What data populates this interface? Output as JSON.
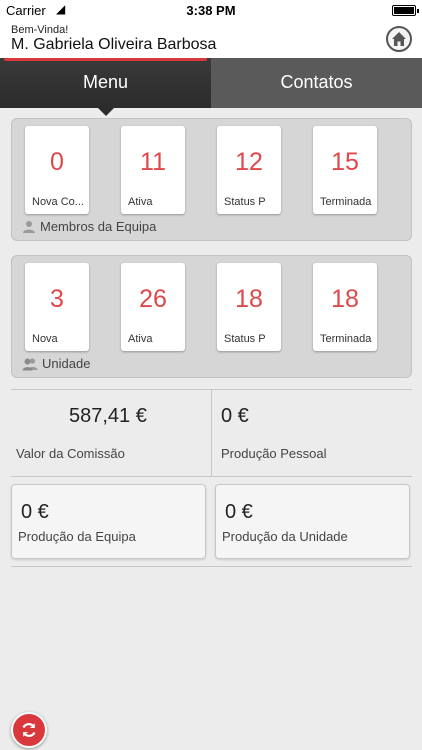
{
  "status_bar": {
    "carrier": "Carrier",
    "time": "3:38 PM"
  },
  "header": {
    "welcome": "Bem-Vinda!",
    "user_name": "M. Gabriela Oliveira Barbosa"
  },
  "tabs": {
    "menu": "Menu",
    "contacts": "Contatos"
  },
  "team_group": {
    "caption": "Membros da Equipa",
    "cards": [
      {
        "value": "0",
        "label": "Nova Co..."
      },
      {
        "value": "11",
        "label": "Ativa"
      },
      {
        "value": "12",
        "label": "Status P"
      },
      {
        "value": "15",
        "label": "Terminada"
      }
    ]
  },
  "unit_group": {
    "caption": "Unidade",
    "cards": [
      {
        "value": "3",
        "label": "Nova"
      },
      {
        "value": "26",
        "label": "Ativa"
      },
      {
        "value": "18",
        "label": "Status P"
      },
      {
        "value": "18",
        "label": "Terminada"
      }
    ]
  },
  "metrics": {
    "commission": {
      "value": "587,41 €",
      "label": "Valor da Comissão"
    },
    "personal": {
      "value": "0 €",
      "label": "Produção Pessoal"
    },
    "team": {
      "value": "0 €",
      "label": "Produção da Equipa"
    },
    "unit": {
      "value": "0 €",
      "label": "Produção da Unidade"
    }
  },
  "colors": {
    "accent": "#e0474a",
    "tab_active": "#2c2c2c",
    "tab_inactive": "#5a5a5a"
  },
  "icons": {
    "home": "home-icon",
    "refresh": "refresh-icon",
    "member": "person-icon",
    "unit": "group-icon"
  }
}
